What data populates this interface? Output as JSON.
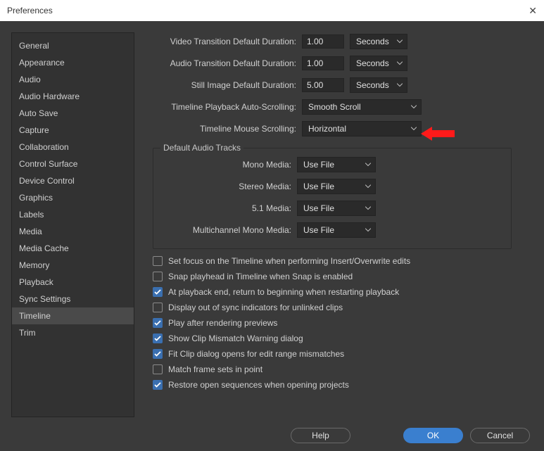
{
  "window": {
    "title": "Preferences"
  },
  "sidebar": {
    "items": [
      {
        "label": "General"
      },
      {
        "label": "Appearance"
      },
      {
        "label": "Audio"
      },
      {
        "label": "Audio Hardware"
      },
      {
        "label": "Auto Save"
      },
      {
        "label": "Capture"
      },
      {
        "label": "Collaboration"
      },
      {
        "label": "Control Surface"
      },
      {
        "label": "Device Control"
      },
      {
        "label": "Graphics"
      },
      {
        "label": "Labels"
      },
      {
        "label": "Media"
      },
      {
        "label": "Media Cache"
      },
      {
        "label": "Memory"
      },
      {
        "label": "Playback"
      },
      {
        "label": "Sync Settings"
      },
      {
        "label": "Timeline"
      },
      {
        "label": "Trim"
      }
    ],
    "selected_index": 16
  },
  "settings": {
    "video_transition": {
      "label": "Video Transition Default Duration:",
      "value": "1.00",
      "unit": "Seconds"
    },
    "audio_transition": {
      "label": "Audio Transition Default Duration:",
      "value": "1.00",
      "unit": "Seconds"
    },
    "still_image": {
      "label": "Still Image Default Duration:",
      "value": "5.00",
      "unit": "Seconds"
    },
    "playback_autoscroll": {
      "label": "Timeline Playback Auto-Scrolling:",
      "value": "Smooth Scroll"
    },
    "mouse_scrolling": {
      "label": "Timeline Mouse Scrolling:",
      "value": "Horizontal"
    }
  },
  "audio_tracks": {
    "legend": "Default Audio Tracks",
    "mono": {
      "label": "Mono Media:",
      "value": "Use File"
    },
    "stereo": {
      "label": "Stereo Media:",
      "value": "Use File"
    },
    "fiveone": {
      "label": "5.1 Media:",
      "value": "Use File"
    },
    "multi": {
      "label": "Multichannel Mono Media:",
      "value": "Use File"
    }
  },
  "checkboxes": [
    {
      "checked": false,
      "label": "Set focus on the Timeline when performing Insert/Overwrite edits"
    },
    {
      "checked": false,
      "label": "Snap playhead in Timeline when Snap is enabled"
    },
    {
      "checked": true,
      "label": "At playback end, return to beginning when restarting playback"
    },
    {
      "checked": false,
      "label": "Display out of sync indicators for unlinked clips"
    },
    {
      "checked": true,
      "label": "Play after rendering previews"
    },
    {
      "checked": true,
      "label": "Show Clip Mismatch Warning dialog"
    },
    {
      "checked": true,
      "label": "Fit Clip dialog opens for edit range mismatches"
    },
    {
      "checked": false,
      "label": "Match frame sets in point"
    },
    {
      "checked": true,
      "label": "Restore open sequences when opening projects"
    }
  ],
  "buttons": {
    "help": "Help",
    "ok": "OK",
    "cancel": "Cancel"
  }
}
